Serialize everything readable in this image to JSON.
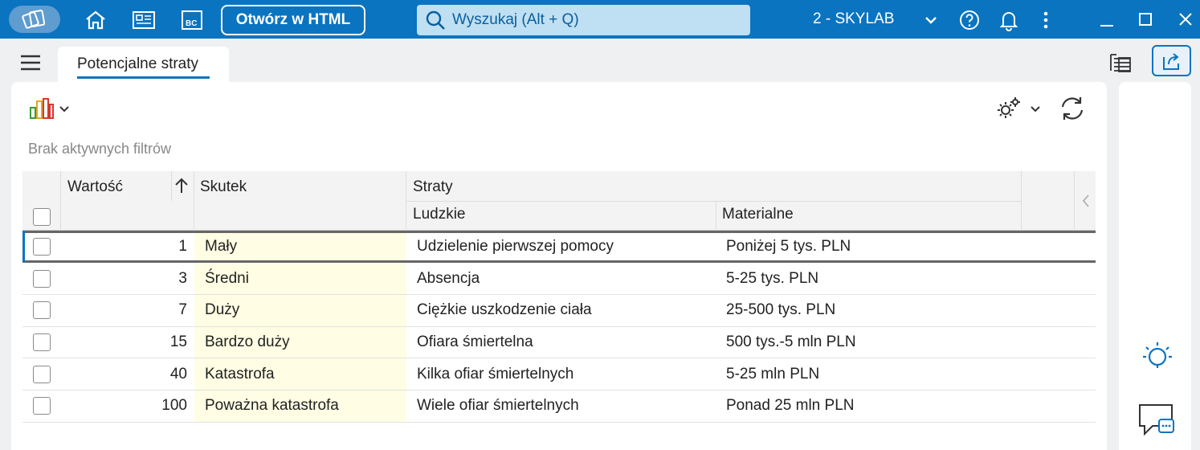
{
  "topbar": {
    "open_html_label": "Otwórz w HTML",
    "search_placeholder": "Wyszukaj (Alt + Q)",
    "company": "2 - SKYLAB",
    "bc_label": "BC"
  },
  "tab": {
    "label": "Potencjalne straty"
  },
  "filter": {
    "text": "Brak aktywnych filtrów"
  },
  "table": {
    "headers": {
      "value": "Wartość",
      "effect": "Skutek",
      "losses": "Straty",
      "human": "Ludzkie",
      "material": "Materialne"
    },
    "rows": [
      {
        "value": "1",
        "effect": "Mały",
        "human": "Udzielenie pierwszej pomocy",
        "material": "Poniżej 5 tys. PLN"
      },
      {
        "value": "3",
        "effect": "Średni",
        "human": "Absencja",
        "material": "5-25 tys. PLN"
      },
      {
        "value": "7",
        "effect": "Duży",
        "human": "Ciężkie uszkodzenie ciała",
        "material": "25-500 tys. PLN"
      },
      {
        "value": "15",
        "effect": "Bardzo duży",
        "human": "Ofiara śmiertelna",
        "material": "500 tys.-5 mln PLN"
      },
      {
        "value": "40",
        "effect": "Katastrofa",
        "human": "Kilka ofiar śmiertelnych",
        "material": "5-25 mln PLN"
      },
      {
        "value": "100",
        "effect": "Poważna katastrofa",
        "human": "Wiele ofiar śmiertelnych",
        "material": "Ponad 25 mln PLN"
      }
    ]
  },
  "colors": {
    "accent": "#0a74c0",
    "effect_bg": "#fffde4"
  }
}
